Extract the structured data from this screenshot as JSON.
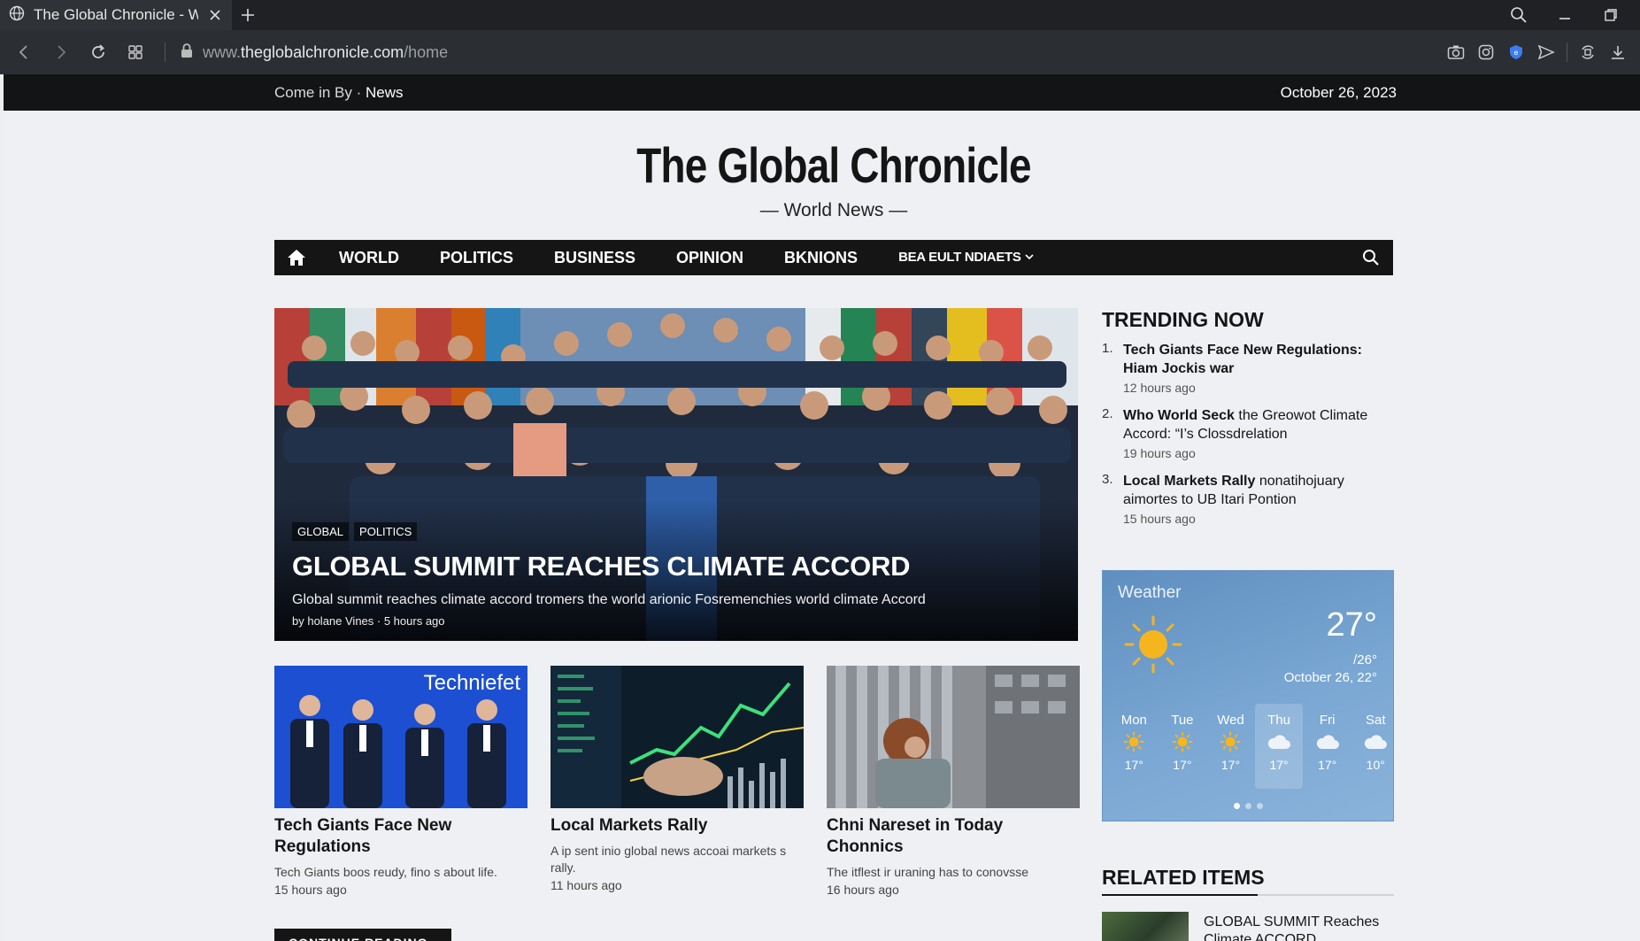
{
  "browser": {
    "tab_title": "The Global Chronicle - Worl",
    "url_prefix": "www.",
    "url_domain": "theglobalchronicle.com",
    "url_path": "/home"
  },
  "topbar": {
    "left_text": "Come in By ·",
    "left_strong": "News",
    "date": "October 26, 2023"
  },
  "masthead": {
    "title": "The Global Chronicle",
    "tagline": "— World News —"
  },
  "nav": {
    "items": [
      "WORLD",
      "POLITICS",
      "BUSINESS",
      "OPINION",
      "BKNIONS",
      "BEA EULT NDIAETS"
    ]
  },
  "hero": {
    "tags": [
      "GLOBAL",
      "POLITICS"
    ],
    "headline": "GLOBAL SUMMIT REACHES CLIMATE ACCORD",
    "dek": "Global summit reaches climate accord tromers the world arionic Fosremenchies world climate Accord",
    "byline": "by holane Vines",
    "age": "5 hours ago"
  },
  "cards": [
    {
      "title": "Tech Giants Face New Regulations",
      "summary": "Tech Giants boos reudy, fino s about life.",
      "age": "15 hours ago",
      "logo": "Techniefet"
    },
    {
      "title": "Local Markets Rally",
      "summary": "A ip sent inio global news accoai markets s rally.",
      "age": "11 hours ago"
    },
    {
      "title": "Chni Nareset in Today Chonnics",
      "summary": "The itflest ir uraning has to conovsse",
      "age": "16 hours ago"
    }
  ],
  "continue_label": "CONTINUE READING",
  "trending": {
    "heading": "TRENDING NOW",
    "items": [
      {
        "num": "1.",
        "bold": "Tech Giants Face New Regulations: Hiam Jockis war",
        "rest": "",
        "age": "12 hours ago"
      },
      {
        "num": "2.",
        "bold": "Who World Seck",
        "rest": " the Greowot Climate Accord: “I’s Clossdrelation",
        "age": "19 hours ago"
      },
      {
        "num": "3.",
        "bold": "Local Markets Rally",
        "rest": " nonatihojuary aimortes to UB Itari Pontion",
        "age": "15 hours ago"
      }
    ]
  },
  "weather": {
    "label": "Weather",
    "temp": "27°",
    "low": "/26°",
    "date": "October 26, 22°",
    "days": [
      {
        "name": "Mon",
        "icon": "sun-icon",
        "temp": "17°"
      },
      {
        "name": "Tue",
        "icon": "sun-icon",
        "temp": "17°"
      },
      {
        "name": "Wed",
        "icon": "sun-icon",
        "temp": "17°"
      },
      {
        "name": "Thu",
        "icon": "cloud-icon",
        "temp": "17°"
      },
      {
        "name": "Fri",
        "icon": "cloud-icon",
        "temp": "17°"
      },
      {
        "name": "Sat",
        "icon": "cloud-icon",
        "temp": "10°"
      }
    ],
    "active_day": "Thu"
  },
  "related": {
    "heading": "RELATED ITEMS",
    "item_title": "GLOBAL SUMMIT Reaches Climate ACCORD"
  },
  "colors": {
    "accent_dark": "#151515",
    "weather_blue": "#6f9dcb",
    "sun_yellow": "#f5b51e"
  }
}
